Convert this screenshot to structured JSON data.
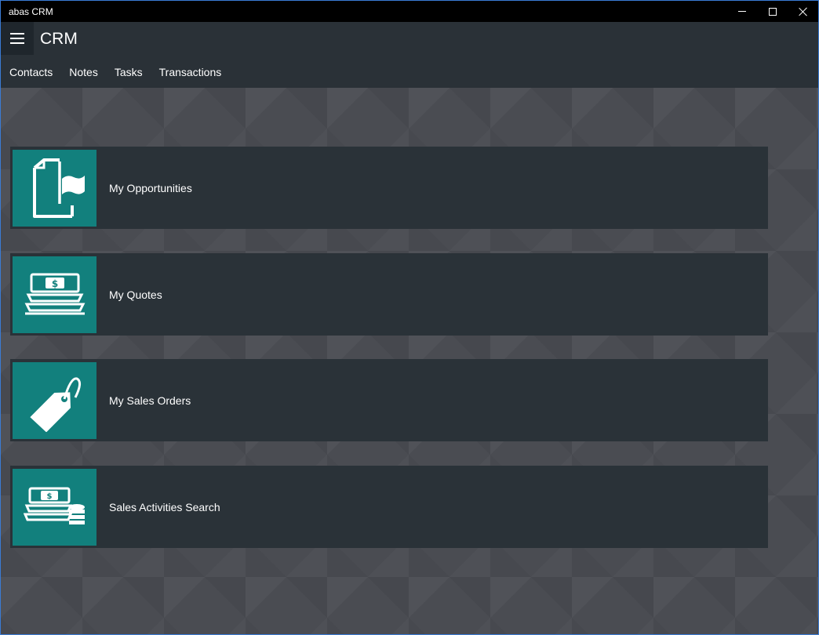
{
  "window": {
    "title": "abas CRM"
  },
  "header": {
    "app_name": "CRM",
    "nav": [
      {
        "label": "Contacts"
      },
      {
        "label": "Notes"
      },
      {
        "label": "Tasks"
      },
      {
        "label": "Transactions"
      }
    ]
  },
  "tiles": [
    {
      "label": "My Opportunities",
      "icon": "flag-document-icon"
    },
    {
      "label": "My Quotes",
      "icon": "money-stack-icon"
    },
    {
      "label": "My Sales Orders",
      "icon": "price-tag-icon"
    },
    {
      "label": "Sales Activities Search",
      "icon": "money-coins-icon"
    }
  ],
  "colors": {
    "accent": "#12807d",
    "tile_bg": "#2a3238",
    "header_bg": "#2a3137",
    "titlebar_bg": "#000000"
  }
}
